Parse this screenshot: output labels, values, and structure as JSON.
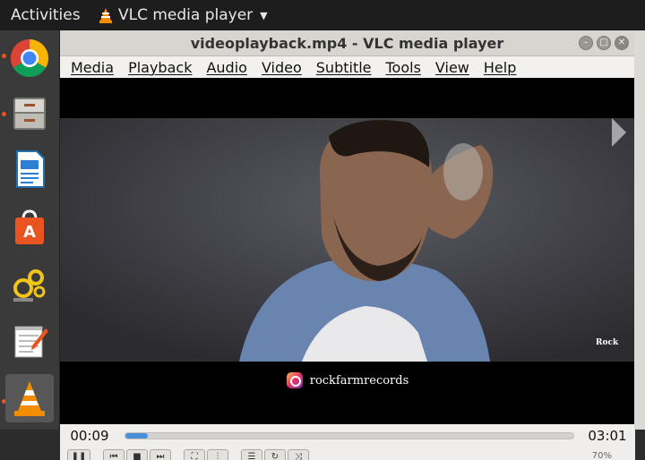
{
  "topbar": {
    "activities_label": "Activities",
    "app_name": "VLC media player"
  },
  "dock": {
    "items": [
      "chrome",
      "files",
      "writer",
      "software-center",
      "settings",
      "text-editor",
      "vlc"
    ]
  },
  "window": {
    "title": "videoplayback.mp4 - VLC media player",
    "buttons": [
      "minimize",
      "maximize",
      "close"
    ]
  },
  "menu": {
    "items": [
      "Media",
      "Playback",
      "Audio",
      "Video",
      "Subtitle",
      "Tools",
      "View",
      "Help"
    ]
  },
  "video": {
    "caption_handle": "rockfarmrecords",
    "watermark": "Rock"
  },
  "playback": {
    "current_time": "00:09",
    "total_time": "03:01",
    "progress": 0.05,
    "volume_label": "70%"
  },
  "colors": {
    "seek_fill": "#4a90d9",
    "ubuntu_orange": "#e95420",
    "vlc_orange": "#f28c00"
  }
}
